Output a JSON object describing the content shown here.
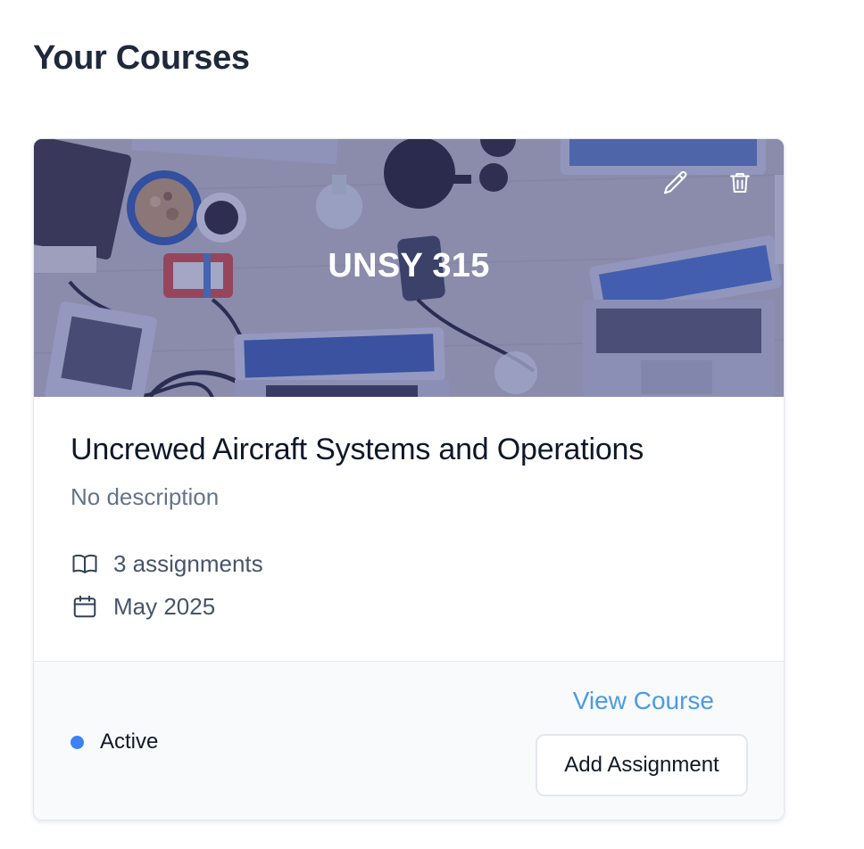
{
  "page": {
    "title": "Your Courses"
  },
  "course": {
    "code": "UNSY 315",
    "name": "Uncrewed Aircraft Systems and Operations",
    "description": "No description",
    "assignments": "3 assignments",
    "date": "May 2025",
    "status": "Active",
    "view_label": "View Course",
    "add_label": "Add Assignment",
    "icons": {
      "edit": "pencil-icon",
      "delete": "trash-icon",
      "assignments": "book-open-icon",
      "date": "calendar-icon"
    }
  },
  "colors": {
    "heading": "#1e293b",
    "link": "#4a9be6",
    "status_dot": "#3b82f6",
    "banner_overlay": "#3741969a",
    "footer_bg": "#f8fafc"
  }
}
